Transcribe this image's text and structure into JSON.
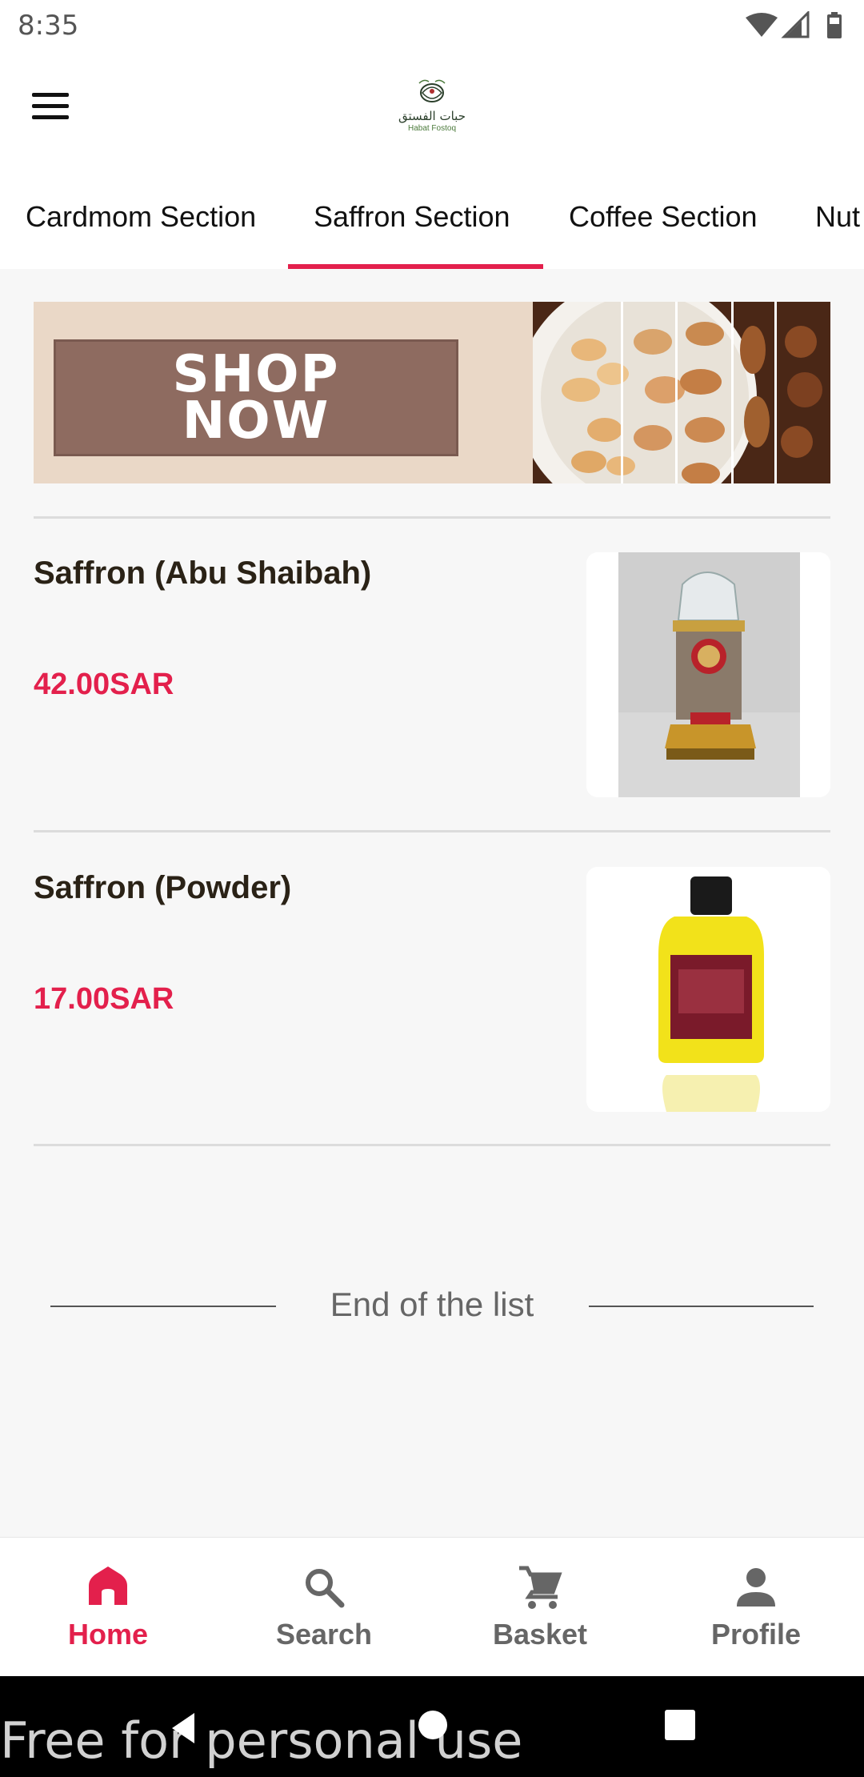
{
  "status_bar": {
    "time": "8:35"
  },
  "header": {
    "logo_arabic": "حبات الفستق",
    "logo_english": "Habat Fostoq"
  },
  "tabs": [
    {
      "label": "Cardmom Section",
      "active": false
    },
    {
      "label": "Saffron Section",
      "active": true
    },
    {
      "label": "Coffee Section",
      "active": false
    },
    {
      "label": "Nut",
      "active": false
    }
  ],
  "banner": {
    "line1": "SHOP",
    "line2": "NOW"
  },
  "products": [
    {
      "name": "Saffron (Abu Shaibah)",
      "price": "42.00SAR"
    },
    {
      "name": "Saffron (Powder)",
      "price": "17.00SAR"
    }
  ],
  "end_of_list": "End of the list",
  "bottom_nav": [
    {
      "label": "Home",
      "icon": "home-icon",
      "active": true
    },
    {
      "label": "Search",
      "icon": "search-icon",
      "active": false
    },
    {
      "label": "Basket",
      "icon": "cart-icon",
      "active": false
    },
    {
      "label": "Profile",
      "icon": "person-icon",
      "active": false
    }
  ],
  "watermark": "Free for personal use",
  "colors": {
    "accent": "#e3204c",
    "text": "#2a2216",
    "banner_box": "#8e6b60"
  }
}
